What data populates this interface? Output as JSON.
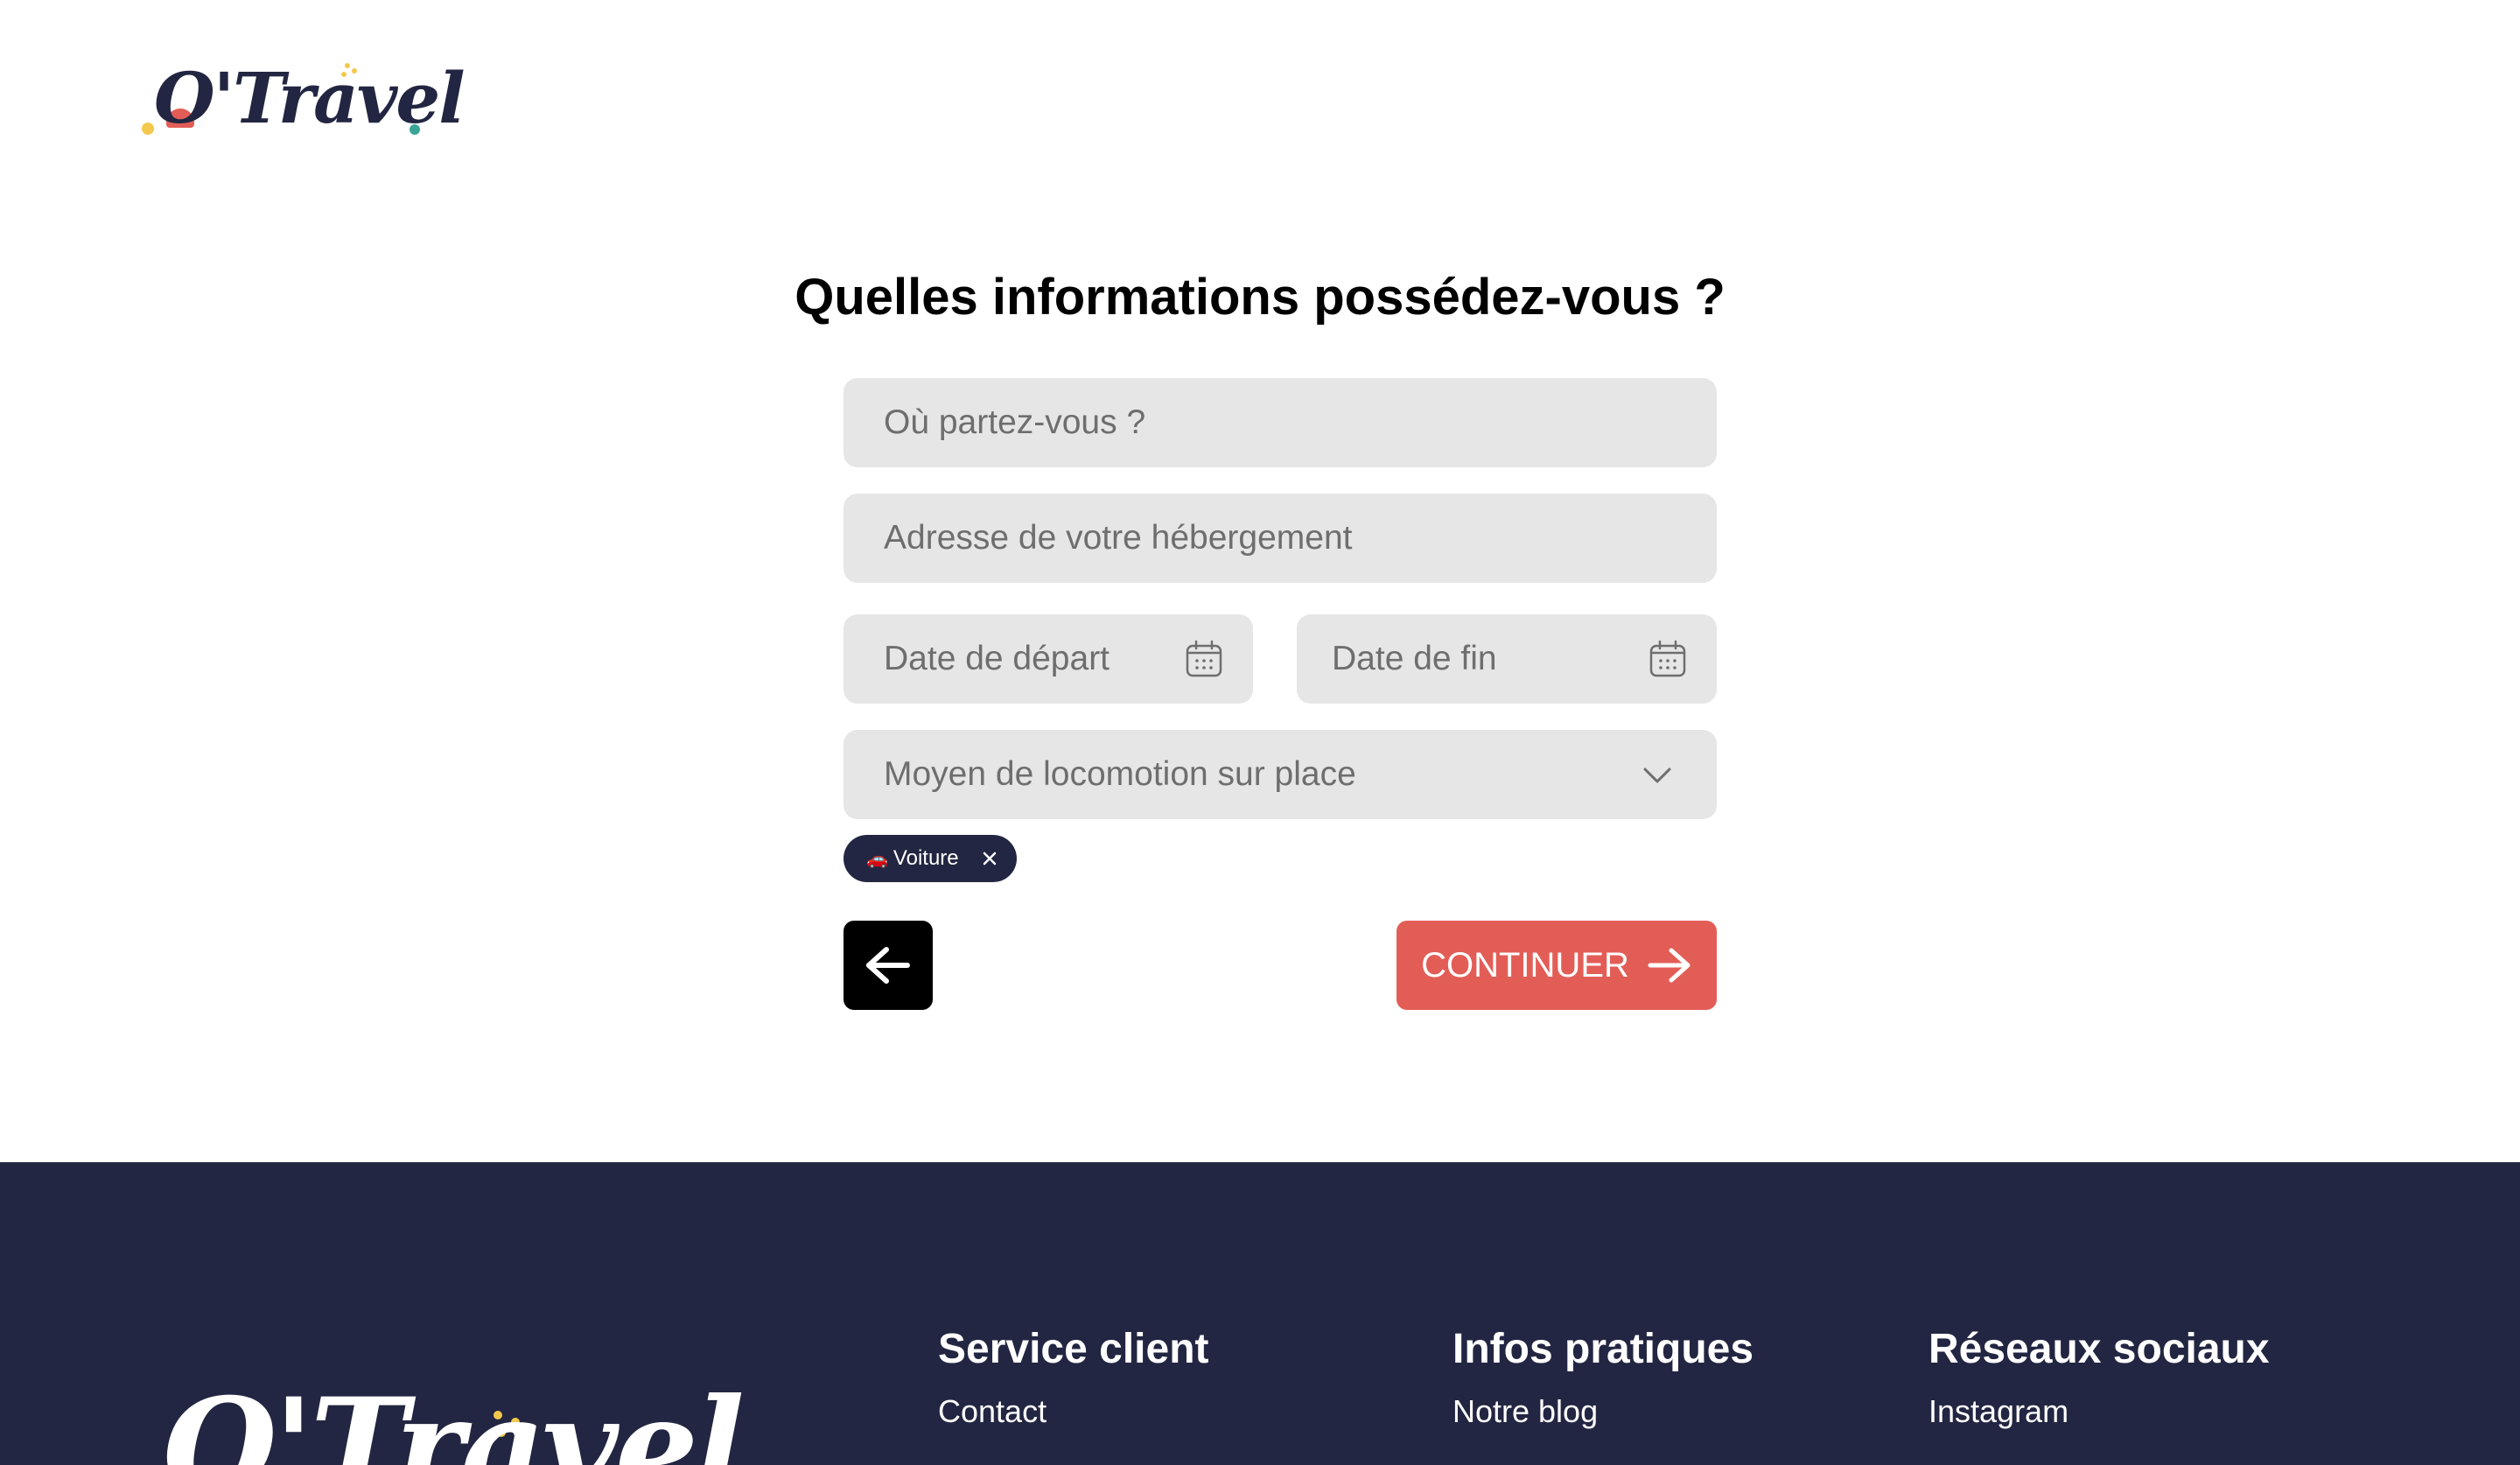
{
  "brand": {
    "logo_text": "O'Travel"
  },
  "form": {
    "title": "Quelles informations possédez-vous ?",
    "destination_placeholder": "Où partez-vous ?",
    "accommodation_placeholder": "Adresse de votre hébergement",
    "start_date_placeholder": "Date de départ",
    "end_date_placeholder": "Date de fin",
    "transport_placeholder": "Moyen de locomotion sur place",
    "selected_chips": [
      {
        "emoji": "🚗",
        "label": "Voiture"
      }
    ],
    "continue_label": "CONTINUER"
  },
  "footer": {
    "logo_text": "O'Travel",
    "columns": [
      {
        "heading": "Service client",
        "links": [
          "Contact"
        ]
      },
      {
        "heading": "Infos pratiques",
        "links": [
          "Notre blog"
        ]
      },
      {
        "heading": "Réseaux sociaux",
        "links": [
          "Instagram"
        ]
      }
    ]
  },
  "colors": {
    "navy": "#232642",
    "accent_red": "#e35d57",
    "field_bg": "#e6e6e6",
    "logo_yellow": "#f2c94c",
    "logo_red": "#e35d57",
    "logo_teal": "#3aa597"
  },
  "icons": {
    "calendar": "calendar-icon",
    "chevron": "chevron-down-icon",
    "close": "close-icon",
    "back": "arrow-left-icon",
    "forward": "arrow-right-icon"
  }
}
